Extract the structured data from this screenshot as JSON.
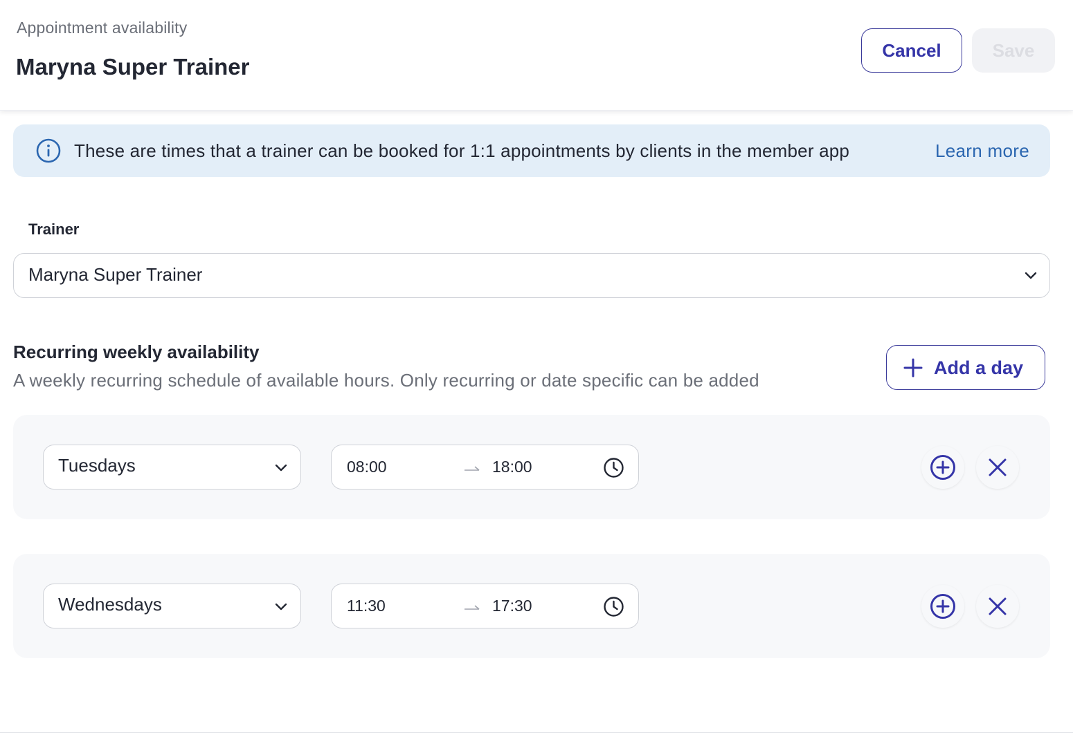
{
  "header": {
    "breadcrumb": "Appointment availability",
    "title": "Maryna Super Trainer",
    "cancel_label": "Cancel",
    "save_label": "Save"
  },
  "info_banner": {
    "icon": "info-icon",
    "text": "These are times that a trainer can be booked for 1:1 appointments by clients in the member app",
    "link_label": "Learn more"
  },
  "trainer": {
    "label": "Trainer",
    "selected": "Maryna Super Trainer"
  },
  "recurring": {
    "title": "Recurring weekly availability",
    "description": "A weekly recurring schedule of available hours. Only recurring or date specific can be added",
    "add_day_label": "Add a day",
    "days": [
      {
        "day": "Tuesdays",
        "start": "08:00",
        "end": "18:00"
      },
      {
        "day": "Wednesdays",
        "start": "11:30",
        "end": "17:30"
      }
    ]
  },
  "colors": {
    "accent": "#3535a8",
    "link": "#2b66b0",
    "banner_bg": "#e3eef8",
    "save_disabled_bg": "#f1f2f5",
    "card_bg": "#f7f8fa"
  }
}
